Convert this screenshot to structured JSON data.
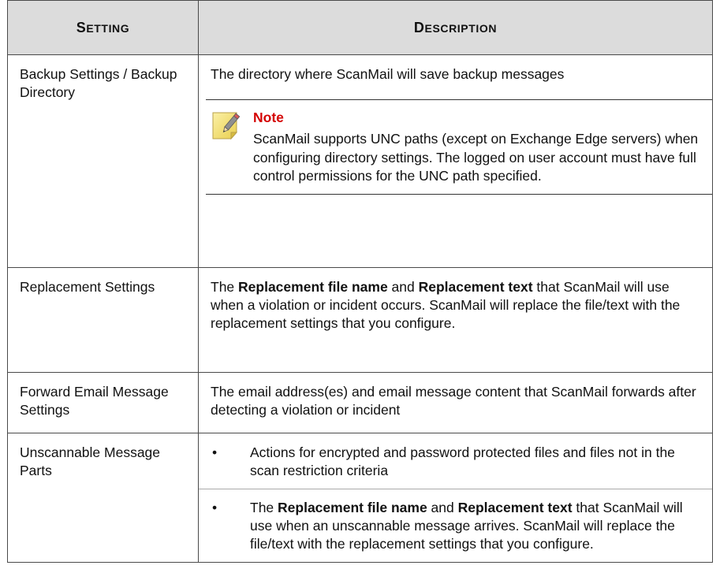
{
  "header": {
    "setting": {
      "first": "S",
      "rest": "ETTING"
    },
    "description": {
      "first": "D",
      "rest": "ESCRIPTION"
    }
  },
  "rows": [
    {
      "setting": "Backup Settings / Backup Directory",
      "description": "The directory where ScanMail will save backup messages",
      "note": {
        "title": "Note",
        "body": "ScanMail supports UNC paths (except on Exchange Edge servers) when configuring directory settings. The logged on user account must have full control permissions for the UNC path specified.",
        "icon": "note-pencil-icon"
      }
    },
    {
      "setting": "Replacement Settings",
      "description": {
        "pre": "The ",
        "bold1": "Replacement file name",
        "mid": " and ",
        "bold2": "Replacement text",
        "post": " that ScanMail will use when a violation or incident occurs. ScanMail will replace the file/text with the replacement settings that you configure."
      }
    },
    {
      "setting": "Forward Email Message Settings",
      "description": "The email address(es) and email message content that ScanMail forwards after detecting a violation or incident"
    },
    {
      "setting": "Unscannable Message Parts",
      "bullets": [
        {
          "marker": "•",
          "text": "Actions for encrypted and password protected files and files not in the scan restriction criteria"
        },
        {
          "marker": "•",
          "pre": "The ",
          "bold1": "Replacement file name",
          "mid": " and ",
          "bold2": "Replacement text",
          "post": " that ScanMail will use when an unscannable message arrives. ScanMail will replace the file/text with the replacement settings that you configure."
        }
      ]
    }
  ],
  "colors": {
    "header_bg": "#dcdcdc",
    "note_title": "#d40000",
    "border": "#4a4a4a",
    "note_icon_fill": "#f6e27a"
  }
}
